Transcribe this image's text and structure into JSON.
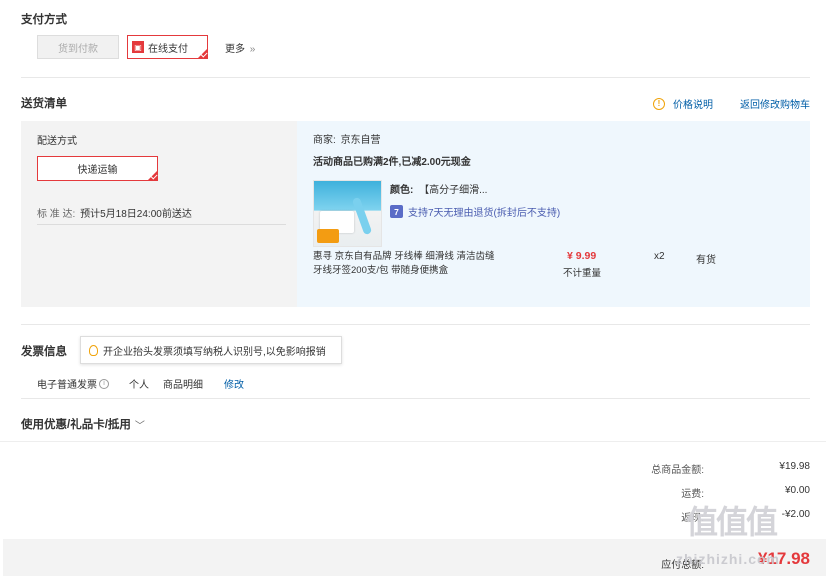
{
  "payment": {
    "title": "支付方式",
    "cod_label": "货到付款",
    "online_label": "在线支付",
    "more_label": "更多",
    "more_arrow": "»"
  },
  "delivery_list": {
    "title": "送货清单",
    "price_note_label": "价格说明",
    "back_to_cart_label": "返回修改购物车"
  },
  "shipping": {
    "title": "配送方式",
    "method_label": "快递运输",
    "standard_label": "标 准 达:",
    "standard_value": "预计5月18日24:00前送达"
  },
  "merchant": {
    "label": "商家:",
    "name": "京东自营",
    "promo": "活动商品已购满2件,已减2.00元现金"
  },
  "product": {
    "color_label": "颜色:",
    "color_value": "【高分子细滑...",
    "return_tag": "7",
    "return_policy": "支持7天无理由退货(拆封后不支持)",
    "name_line1": "惠寻 京东自有品牌 牙线棒 细滑线 清洁齿缝",
    "name_line2": "牙线牙签200支/包 带随身便携盒",
    "price": "¥ 9.99",
    "weight_note": "不计重量",
    "quantity": "x2",
    "stock": "有货"
  },
  "invoice": {
    "title": "发票信息",
    "tip": "开企业抬头发票须填写纳税人识别号,以免影响报销",
    "type": "电子普通发票",
    "info_icon": "i",
    "holder": "个人",
    "content": "商品明细",
    "modify_label": "修改"
  },
  "coupons": {
    "title": "使用优惠/礼品卡/抵用",
    "chevron": "﹀"
  },
  "summary": {
    "total_goods_label": "总商品金额:",
    "total_goods_value": "¥19.98",
    "shipping_label": "运费:",
    "shipping_value": "¥0.00",
    "discount_label": "返现:",
    "discount_value": "-¥2.00",
    "payable_label": "应付总额:",
    "payable_value": "¥17.98"
  },
  "watermark": {
    "big": "值值值",
    "site": "zhizhizhi.com"
  },
  "colors": {
    "accent": "#e4393c",
    "link": "#005ea7",
    "delivery_left_bg": "#f3f3f3",
    "delivery_right_bg": "#eff7fd"
  }
}
